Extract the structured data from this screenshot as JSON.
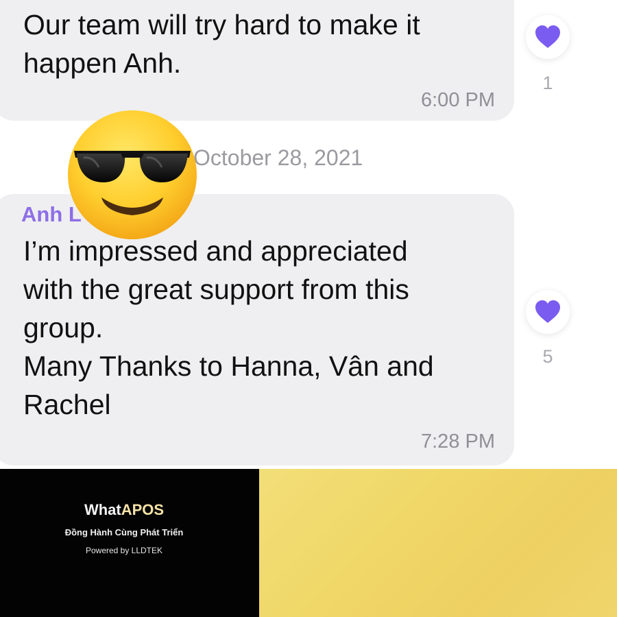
{
  "messages": [
    {
      "text": "Our team will try hard to make it\nhappen Anh.",
      "time": "6:00 PM",
      "reaction": {
        "icon": "heart-icon",
        "count": "1",
        "color": "#7b5cf0"
      }
    },
    {
      "sender": "Anh L",
      "text": "I’m impressed and appreciated\nwith the great support from this\ngroup.\nMany Thanks to Hanna, Vân and\nRachel",
      "time": "7:28 PM",
      "reaction": {
        "icon": "heart-icon",
        "count": "5",
        "color": "#7b5cf0"
      }
    }
  ],
  "date_separator": "October 28, 2021",
  "overlay": {
    "icon": "sunglasses-emoji-icon"
  },
  "banner": {
    "brand_prefix": "What",
    "brand_suffix": "APOS",
    "tagline": "Đồng Hành Cùng Phát Triển",
    "powered_by": "Powered by LLDTEK",
    "left_color": "#030303",
    "right_color": "#f0d767"
  }
}
